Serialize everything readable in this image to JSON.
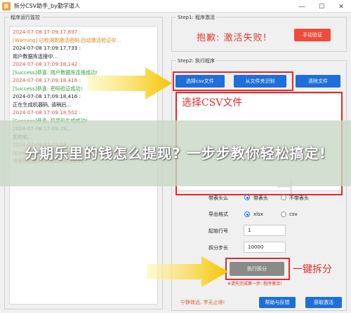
{
  "window": {
    "title": "拆分CSV助手_by勤学道人",
    "icon_glyph": "拆",
    "controls": [
      "minimize-icon",
      "maximize-icon",
      "close-icon"
    ]
  },
  "log_panel": {
    "title": "程序运行监控",
    "lines": [
      {
        "text": "2024-07-08 17:09:17,697 :",
        "kind": "ts"
      },
      {
        "text": "[Warning] 已检测到激活密码,自动激活验证中...",
        "kind": "warn"
      },
      {
        "text": "2024-07-08 17:09:17,733 :",
        "kind": "ts2"
      },
      {
        "text": "用户数据库连接中...",
        "kind": "plain"
      },
      {
        "text": "2024-07-08 17:09:18,142 :",
        "kind": "ts"
      },
      {
        "text": "[Success]恭喜: 用户数据库连接成功!",
        "kind": "ok"
      },
      {
        "text": "2024-07-08 17:09:18,416 :",
        "kind": "ts"
      },
      {
        "text": "[Success]恭喜: 密码验证成功!",
        "kind": "ok"
      },
      {
        "text": "2024-07-08 17:09:18,416 :",
        "kind": "ts2"
      },
      {
        "text": "正在生成机器码, 请稍后...",
        "kind": "plain"
      },
      {
        "text": "2024-07-08 17:09:18,502 :",
        "kind": "ts"
      },
      {
        "text": "[Success]恭喜: 机器码生成成功!",
        "kind": "ok"
      },
      {
        "text": "2024-07-08 17:09:19,...",
        "kind": "ts2"
      },
      {
        "text": "您的机...",
        "kind": "plain"
      },
      {
        "text": "2024-07-08 17:09:19,...",
        "kind": "ts"
      },
      {
        "text": "[Error]机器码验证不通过: 密码已被其他电脑激活!",
        "kind": "err"
      },
      {
        "text": "请使用机器码申请新的激活密码!",
        "kind": "err"
      }
    ]
  },
  "step1": {
    "title": "Step1: 程序激活",
    "status_text": "抱歉: 激活失败!",
    "activate_button": "手动验证"
  },
  "step2": {
    "title": "Step2: 执行程序",
    "select_csv_button": "选择csv文件",
    "from_folder_button": "从文件夹识别",
    "clear_button": "清除文件",
    "annotation_select": "选择CSV文件",
    "header_label": "带表头么",
    "header_yes": "带表头",
    "header_no": "不带表头",
    "format_label": "导出格式",
    "format_xlsx": "xlsx",
    "format_csv": "csv",
    "start_row_label": "起始行号",
    "start_row_value": "1",
    "step_label": "拆分步长",
    "step_value": "10000",
    "run_button": "执行拆分",
    "annotation_run": "一键拆分",
    "run_hint": "※请先完成第一步: 程序激活!",
    "footer_slogan": "宁静致远, 学无止境!",
    "help_button": "帮助与反馈",
    "get_activation_button": "获取激活"
  },
  "banner": {
    "text": "分期乐里的钱怎么提现? 一步步教你轻松搞定!"
  },
  "colors": {
    "accent_blue": "#1e6fd9",
    "danger_red": "#f04b3a",
    "annotation_red": "#e22a2a",
    "arrow_yellow": "#f5c400",
    "success_green": "#2e9e3c",
    "warning_orange": "#d9821f"
  }
}
